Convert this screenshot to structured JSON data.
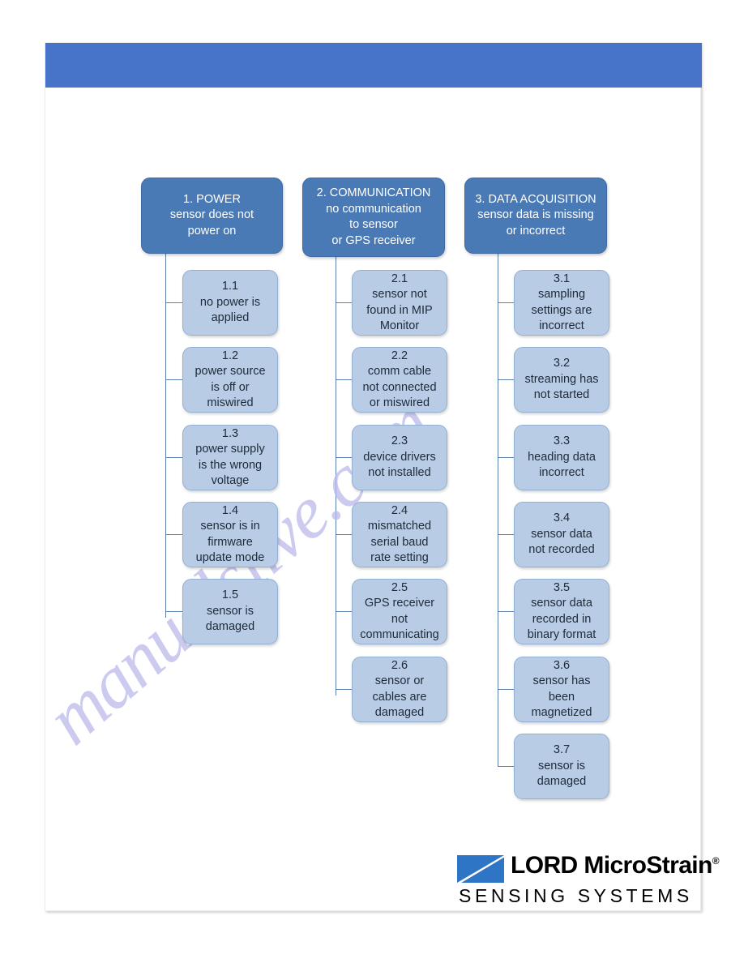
{
  "page": {
    "banner_color": "#4774C8",
    "sheet_background": "#ffffff"
  },
  "watermark": {
    "text": "manualslive.com",
    "color": "#b9b8ea"
  },
  "diagram": {
    "type": "troubleshooting-tree",
    "title": "",
    "parent_color": "#4A7AB5",
    "child_color": "#B9CCE6",
    "connector_color": "#5b7fae",
    "columns": [
      {
        "id": "col-1",
        "parent": {
          "number": "1.",
          "heading": "POWER",
          "label": "1.  POWER\nsensor does not\npower on"
        },
        "children": [
          {
            "number": "1.1",
            "label": "1.1\nno power is\napplied"
          },
          {
            "number": "1.2",
            "label": "1.2\npower source\nis off or\nmiswired"
          },
          {
            "number": "1.3",
            "label": "1.3\npower supply\nis the wrong\nvoltage"
          },
          {
            "number": "1.4",
            "label": "1.4\nsensor is in\nfirmware\nupdate mode"
          },
          {
            "number": "1.5",
            "label": "1.5\nsensor is\ndamaged"
          }
        ]
      },
      {
        "id": "col-2",
        "parent": {
          "number": "2.",
          "heading": "COMMUNICATION",
          "label": "2.  COMMUNICATION\nno communication\nto sensor\nor GPS receiver"
        },
        "children": [
          {
            "number": "2.1",
            "label": "2.1\nsensor not\nfound in MIP\nMonitor"
          },
          {
            "number": "2.2",
            "label": "2.2\ncomm cable\nnot connected\nor miswired"
          },
          {
            "number": "2.3",
            "label": "2.3\ndevice drivers\nnot installed"
          },
          {
            "number": "2.4",
            "label": "2.4\nmismatched\nserial baud\nrate setting"
          },
          {
            "number": "2.5",
            "label": "2.5\nGPS receiver\nnot\ncommunicating"
          },
          {
            "number": "2.6",
            "label": "2.6\nsensor or\ncables are\ndamaged"
          }
        ]
      },
      {
        "id": "col-3",
        "parent": {
          "number": "3.",
          "heading": "DATA ACQUISITION",
          "label": "3.  DATA ACQUISITION\nsensor data is missing\nor incorrect"
        },
        "children": [
          {
            "number": "3.1",
            "label": "3.1\nsampling\nsettings are\nincorrect"
          },
          {
            "number": "3.2",
            "label": "3.2\nstreaming has\nnot started"
          },
          {
            "number": "3.3",
            "label": "3.3\nheading data\nincorrect"
          },
          {
            "number": "3.4",
            "label": "3.4\nsensor data\nnot recorded"
          },
          {
            "number": "3.5",
            "label": "3.5\nsensor data\nrecorded in\nbinary format"
          },
          {
            "number": "3.6",
            "label": "3.6\nsensor has\nbeen\nmagnetized"
          },
          {
            "number": "3.7",
            "label": "3.7\nsensor is\ndamaged"
          }
        ]
      }
    ]
  },
  "logo": {
    "brand": "LORD MicroStrain",
    "registered_mark": "®",
    "tagline": "SENSING SYSTEMS",
    "mark_color": "#2E75C6"
  }
}
